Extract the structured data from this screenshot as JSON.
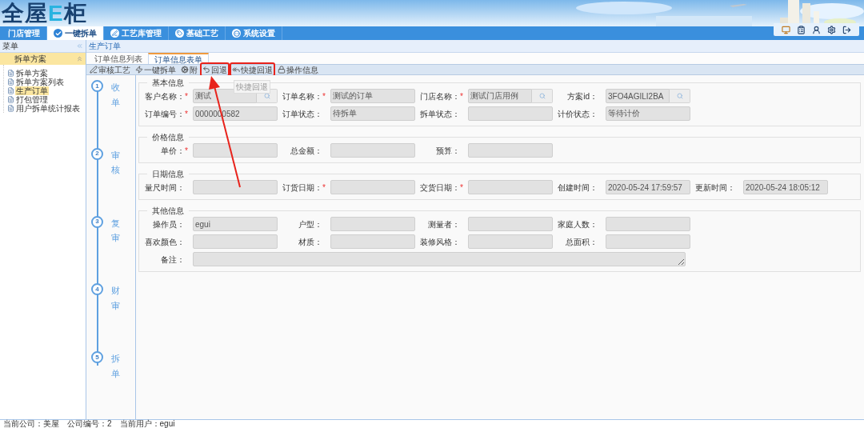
{
  "header": {
    "logo": [
      {
        "kind": "plain",
        "text": "全屋"
      },
      {
        "kind": "accent",
        "text": "E"
      },
      {
        "kind": "plain",
        "text": "柜"
      }
    ],
    "tools": [
      {
        "kind": "screen"
      },
      {
        "kind": "clipboard"
      },
      {
        "kind": "user"
      },
      {
        "kind": "settings"
      },
      {
        "kind": "exit"
      }
    ]
  },
  "nav": [
    {
      "label": "门店管理",
      "kind": "plain",
      "selected": false
    },
    {
      "label": "一键拆单",
      "kind": "check",
      "selected": true
    },
    {
      "label": "工艺库管理",
      "kind": "pen",
      "selected": false
    },
    {
      "label": "基础工艺",
      "kind": "tag",
      "selected": false
    },
    {
      "label": "系统设置",
      "kind": "dots",
      "selected": false
    }
  ],
  "sidebar": {
    "title": "菜单",
    "group": "拆单方案",
    "items": [
      {
        "label": "拆单方案",
        "selected": false
      },
      {
        "label": "拆单方案列表",
        "selected": false
      },
      {
        "label": "生产订单",
        "selected": true
      },
      {
        "label": "打包管理",
        "selected": false
      },
      {
        "label": "用户拆单统计报表",
        "selected": false
      }
    ]
  },
  "breadcrumb": "生产订单",
  "tabs": [
    {
      "label": "订单信息列表",
      "selected": false
    },
    {
      "label": "订单信息表单",
      "selected": true
    }
  ],
  "toolbar": [
    {
      "label": "审核工艺",
      "kind": "pen",
      "highlighted": false
    },
    {
      "label": "一键拆单",
      "kind": "bolt",
      "highlighted": false
    },
    {
      "label": "附",
      "kind": "gear",
      "highlighted": false
    },
    {
      "label": "回退",
      "kind": "back",
      "highlighted": true
    },
    {
      "label": "快捷回退",
      "kind": "backall",
      "highlighted": true
    },
    {
      "label": "操作信息",
      "kind": "lock",
      "highlighted": false
    }
  ],
  "tooltip": "快捷回退",
  "callout_arrow": true,
  "steps": [
    {
      "number": "1",
      "label": "收单"
    },
    {
      "number": "2",
      "label": "审核"
    },
    {
      "number": "3",
      "label": "复审"
    },
    {
      "number": "4",
      "label": "财审"
    },
    {
      "number": "5",
      "label": "拆单"
    }
  ],
  "sections": [
    {
      "title": "基本信息",
      "rows": [
        [
          {
            "label": "客户名称：",
            "mark": "*",
            "value": "测试",
            "kind": "lookup"
          },
          {
            "label": "订单名称：",
            "mark": "*",
            "value": "测试的订单",
            "kind": "text"
          },
          {
            "label": "门店名称：",
            "mark": "*",
            "value": "测试门店用例",
            "kind": "lookup"
          },
          {
            "label": "方案id：",
            "value": "3FO4AGILI2BA",
            "kind": "lookup"
          }
        ],
        [
          {
            "label": "订单编号：",
            "mark": "*",
            "value": "0000000582",
            "kind": "text"
          },
          {
            "label": "订单状态：",
            "value": "待拆单",
            "kind": "text"
          },
          {
            "label": "拆单状态：",
            "kind": "text"
          },
          {
            "label": "计价状态：",
            "value": "等待计价",
            "kind": "text"
          }
        ]
      ]
    },
    {
      "title": "价格信息",
      "rows": [
        [
          {
            "label": "单价：",
            "mark": "*",
            "kind": "text"
          },
          {
            "label": "总金额：",
            "kind": "text"
          },
          {
            "label": "预算：",
            "kind": "text"
          }
        ]
      ]
    },
    {
      "title": "日期信息",
      "rows": [
        [
          {
            "label": "量尺时间：",
            "kind": "text"
          },
          {
            "label": "订货日期：",
            "mark": "*",
            "kind": "text"
          },
          {
            "label": "交货日期：",
            "mark": "*",
            "kind": "text"
          },
          {
            "label": "创建时间：",
            "value": "2020-05-24 17:59:57",
            "kind": "text"
          },
          {
            "label": "更新时间：",
            "value": "2020-05-24 18:05:12",
            "kind": "text"
          }
        ]
      ]
    },
    {
      "title": "其他信息",
      "rows": [
        [
          {
            "label": "操作员：",
            "value": "egui",
            "kind": "text"
          },
          {
            "label": "户型：",
            "kind": "text"
          },
          {
            "label": "测量者：",
            "kind": "text"
          },
          {
            "label": "家庭人数：",
            "kind": "text"
          }
        ],
        [
          {
            "label": "喜欢颜色：",
            "kind": "text"
          },
          {
            "label": "材质：",
            "kind": "text"
          },
          {
            "label": "装修风格：",
            "kind": "text"
          },
          {
            "label": "总面积：",
            "kind": "text"
          }
        ],
        [
          {
            "label": "备注：",
            "kind": "textarea"
          }
        ]
      ]
    }
  ],
  "status_bar": [
    "当前公司：美屋",
    "公司编号：2",
    "当前用户：egui"
  ]
}
